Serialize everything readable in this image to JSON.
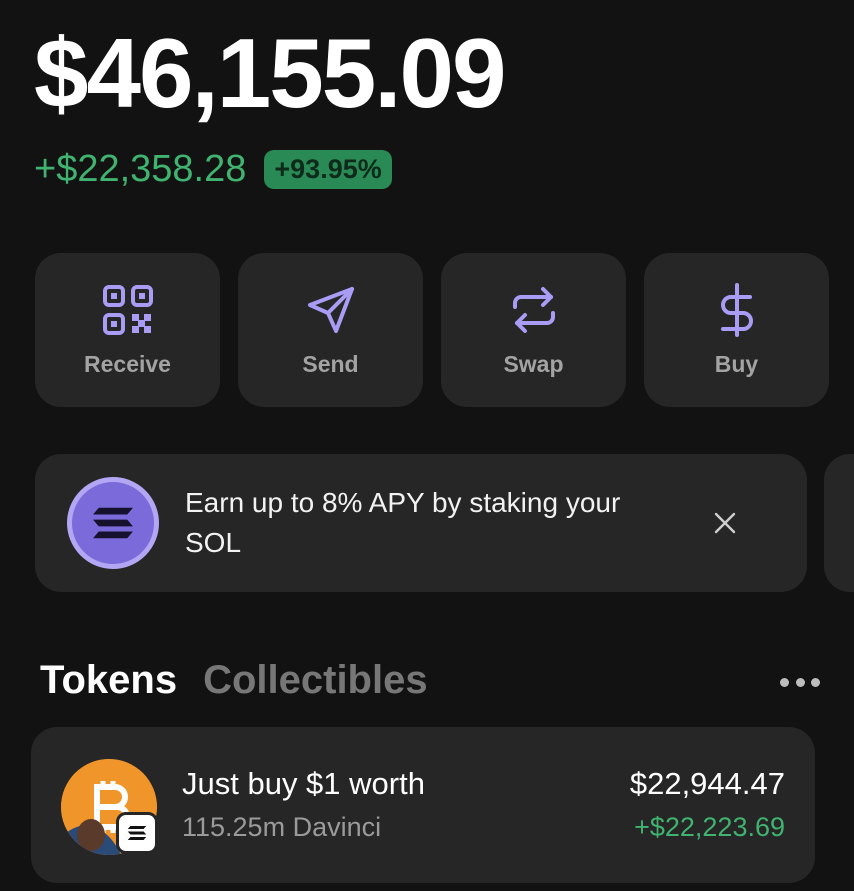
{
  "portfolio": {
    "balance": "$46,155.09",
    "change_amount": "+$22,358.28",
    "change_percent": "+93.95%"
  },
  "actions": [
    {
      "label": "Receive",
      "icon": "qr-code-icon"
    },
    {
      "label": "Send",
      "icon": "send-icon"
    },
    {
      "label": "Swap",
      "icon": "swap-icon"
    },
    {
      "label": "Buy",
      "icon": "dollar-icon"
    }
  ],
  "promo": {
    "text": "Earn up to 8% APY by staking your SOL",
    "icon": "solana-icon"
  },
  "tabs": [
    {
      "label": "Tokens",
      "active": true
    },
    {
      "label": "Collectibles",
      "active": false
    }
  ],
  "tokens": [
    {
      "name": "Just buy $1 worth",
      "amount": "115.25m Davinci",
      "value": "$22,944.47",
      "change": "+$22,223.69",
      "chain": "solana-icon"
    }
  ],
  "colors": {
    "background": "#121212",
    "card": "#262626",
    "accent": "#a89cf5",
    "positive": "#3fb36f",
    "badge": "#2a8a55"
  }
}
